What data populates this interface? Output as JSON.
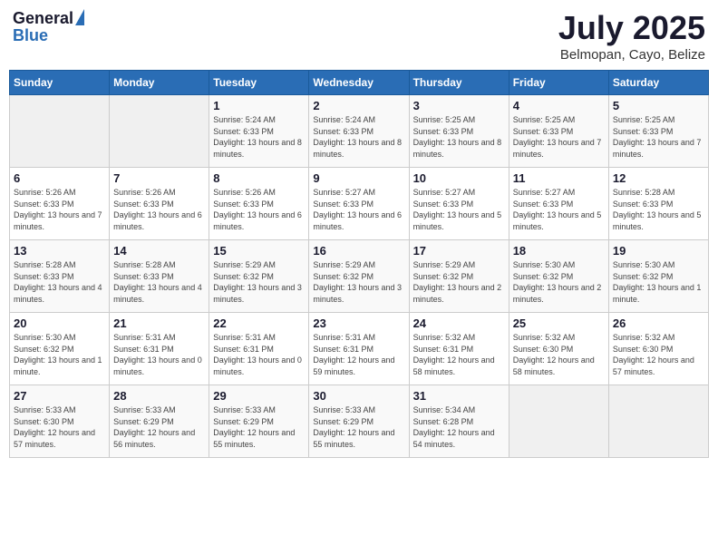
{
  "header": {
    "logo_general": "General",
    "logo_blue": "Blue",
    "month_title": "July 2025",
    "subtitle": "Belmopan, Cayo, Belize"
  },
  "days_of_week": [
    "Sunday",
    "Monday",
    "Tuesday",
    "Wednesday",
    "Thursday",
    "Friday",
    "Saturday"
  ],
  "weeks": [
    [
      {
        "num": "",
        "sunrise": "",
        "sunset": "",
        "daylight": ""
      },
      {
        "num": "",
        "sunrise": "",
        "sunset": "",
        "daylight": ""
      },
      {
        "num": "1",
        "sunrise": "Sunrise: 5:24 AM",
        "sunset": "Sunset: 6:33 PM",
        "daylight": "Daylight: 13 hours and 8 minutes."
      },
      {
        "num": "2",
        "sunrise": "Sunrise: 5:24 AM",
        "sunset": "Sunset: 6:33 PM",
        "daylight": "Daylight: 13 hours and 8 minutes."
      },
      {
        "num": "3",
        "sunrise": "Sunrise: 5:25 AM",
        "sunset": "Sunset: 6:33 PM",
        "daylight": "Daylight: 13 hours and 8 minutes."
      },
      {
        "num": "4",
        "sunrise": "Sunrise: 5:25 AM",
        "sunset": "Sunset: 6:33 PM",
        "daylight": "Daylight: 13 hours and 7 minutes."
      },
      {
        "num": "5",
        "sunrise": "Sunrise: 5:25 AM",
        "sunset": "Sunset: 6:33 PM",
        "daylight": "Daylight: 13 hours and 7 minutes."
      }
    ],
    [
      {
        "num": "6",
        "sunrise": "Sunrise: 5:26 AM",
        "sunset": "Sunset: 6:33 PM",
        "daylight": "Daylight: 13 hours and 7 minutes."
      },
      {
        "num": "7",
        "sunrise": "Sunrise: 5:26 AM",
        "sunset": "Sunset: 6:33 PM",
        "daylight": "Daylight: 13 hours and 6 minutes."
      },
      {
        "num": "8",
        "sunrise": "Sunrise: 5:26 AM",
        "sunset": "Sunset: 6:33 PM",
        "daylight": "Daylight: 13 hours and 6 minutes."
      },
      {
        "num": "9",
        "sunrise": "Sunrise: 5:27 AM",
        "sunset": "Sunset: 6:33 PM",
        "daylight": "Daylight: 13 hours and 6 minutes."
      },
      {
        "num": "10",
        "sunrise": "Sunrise: 5:27 AM",
        "sunset": "Sunset: 6:33 PM",
        "daylight": "Daylight: 13 hours and 5 minutes."
      },
      {
        "num": "11",
        "sunrise": "Sunrise: 5:27 AM",
        "sunset": "Sunset: 6:33 PM",
        "daylight": "Daylight: 13 hours and 5 minutes."
      },
      {
        "num": "12",
        "sunrise": "Sunrise: 5:28 AM",
        "sunset": "Sunset: 6:33 PM",
        "daylight": "Daylight: 13 hours and 5 minutes."
      }
    ],
    [
      {
        "num": "13",
        "sunrise": "Sunrise: 5:28 AM",
        "sunset": "Sunset: 6:33 PM",
        "daylight": "Daylight: 13 hours and 4 minutes."
      },
      {
        "num": "14",
        "sunrise": "Sunrise: 5:28 AM",
        "sunset": "Sunset: 6:33 PM",
        "daylight": "Daylight: 13 hours and 4 minutes."
      },
      {
        "num": "15",
        "sunrise": "Sunrise: 5:29 AM",
        "sunset": "Sunset: 6:32 PM",
        "daylight": "Daylight: 13 hours and 3 minutes."
      },
      {
        "num": "16",
        "sunrise": "Sunrise: 5:29 AM",
        "sunset": "Sunset: 6:32 PM",
        "daylight": "Daylight: 13 hours and 3 minutes."
      },
      {
        "num": "17",
        "sunrise": "Sunrise: 5:29 AM",
        "sunset": "Sunset: 6:32 PM",
        "daylight": "Daylight: 13 hours and 2 minutes."
      },
      {
        "num": "18",
        "sunrise": "Sunrise: 5:30 AM",
        "sunset": "Sunset: 6:32 PM",
        "daylight": "Daylight: 13 hours and 2 minutes."
      },
      {
        "num": "19",
        "sunrise": "Sunrise: 5:30 AM",
        "sunset": "Sunset: 6:32 PM",
        "daylight": "Daylight: 13 hours and 1 minute."
      }
    ],
    [
      {
        "num": "20",
        "sunrise": "Sunrise: 5:30 AM",
        "sunset": "Sunset: 6:32 PM",
        "daylight": "Daylight: 13 hours and 1 minute."
      },
      {
        "num": "21",
        "sunrise": "Sunrise: 5:31 AM",
        "sunset": "Sunset: 6:31 PM",
        "daylight": "Daylight: 13 hours and 0 minutes."
      },
      {
        "num": "22",
        "sunrise": "Sunrise: 5:31 AM",
        "sunset": "Sunset: 6:31 PM",
        "daylight": "Daylight: 13 hours and 0 minutes."
      },
      {
        "num": "23",
        "sunrise": "Sunrise: 5:31 AM",
        "sunset": "Sunset: 6:31 PM",
        "daylight": "Daylight: 12 hours and 59 minutes."
      },
      {
        "num": "24",
        "sunrise": "Sunrise: 5:32 AM",
        "sunset": "Sunset: 6:31 PM",
        "daylight": "Daylight: 12 hours and 58 minutes."
      },
      {
        "num": "25",
        "sunrise": "Sunrise: 5:32 AM",
        "sunset": "Sunset: 6:30 PM",
        "daylight": "Daylight: 12 hours and 58 minutes."
      },
      {
        "num": "26",
        "sunrise": "Sunrise: 5:32 AM",
        "sunset": "Sunset: 6:30 PM",
        "daylight": "Daylight: 12 hours and 57 minutes."
      }
    ],
    [
      {
        "num": "27",
        "sunrise": "Sunrise: 5:33 AM",
        "sunset": "Sunset: 6:30 PM",
        "daylight": "Daylight: 12 hours and 57 minutes."
      },
      {
        "num": "28",
        "sunrise": "Sunrise: 5:33 AM",
        "sunset": "Sunset: 6:29 PM",
        "daylight": "Daylight: 12 hours and 56 minutes."
      },
      {
        "num": "29",
        "sunrise": "Sunrise: 5:33 AM",
        "sunset": "Sunset: 6:29 PM",
        "daylight": "Daylight: 12 hours and 55 minutes."
      },
      {
        "num": "30",
        "sunrise": "Sunrise: 5:33 AM",
        "sunset": "Sunset: 6:29 PM",
        "daylight": "Daylight: 12 hours and 55 minutes."
      },
      {
        "num": "31",
        "sunrise": "Sunrise: 5:34 AM",
        "sunset": "Sunset: 6:28 PM",
        "daylight": "Daylight: 12 hours and 54 minutes."
      },
      {
        "num": "",
        "sunrise": "",
        "sunset": "",
        "daylight": ""
      },
      {
        "num": "",
        "sunrise": "",
        "sunset": "",
        "daylight": ""
      }
    ]
  ]
}
